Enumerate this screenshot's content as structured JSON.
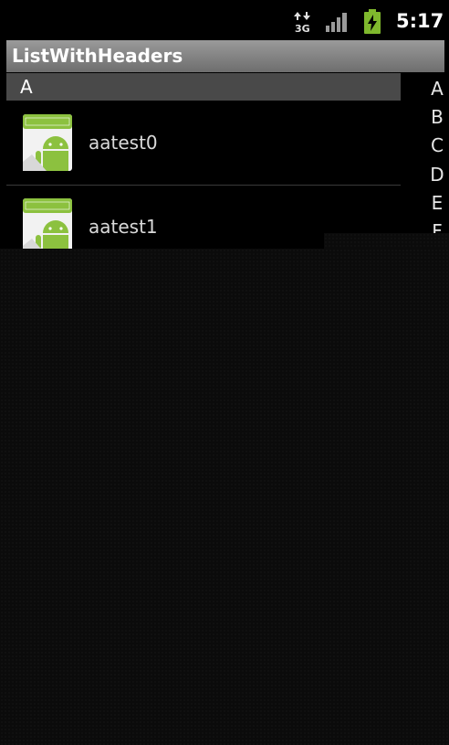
{
  "status_bar": {
    "network": "3G",
    "time": "5:17",
    "icons": [
      "network-3g-icon",
      "signal-icon",
      "battery-charging-icon"
    ]
  },
  "title_bar": {
    "title": "ListWithHeaders"
  },
  "list": {
    "section_header": "A",
    "items": [
      {
        "label": "aatest0",
        "icon": "android-app-icon"
      },
      {
        "label": "aatest1",
        "icon": "android-app-icon"
      }
    ]
  },
  "index_bar": {
    "letters": [
      "A",
      "B",
      "C",
      "D",
      "E",
      "F"
    ]
  },
  "colors": {
    "title_bar_gradient_top": "#9a9a9a",
    "title_bar_gradient_bottom": "#6e6e6e",
    "section_header_bg": "#494949",
    "android_green": "#8cc13f"
  }
}
